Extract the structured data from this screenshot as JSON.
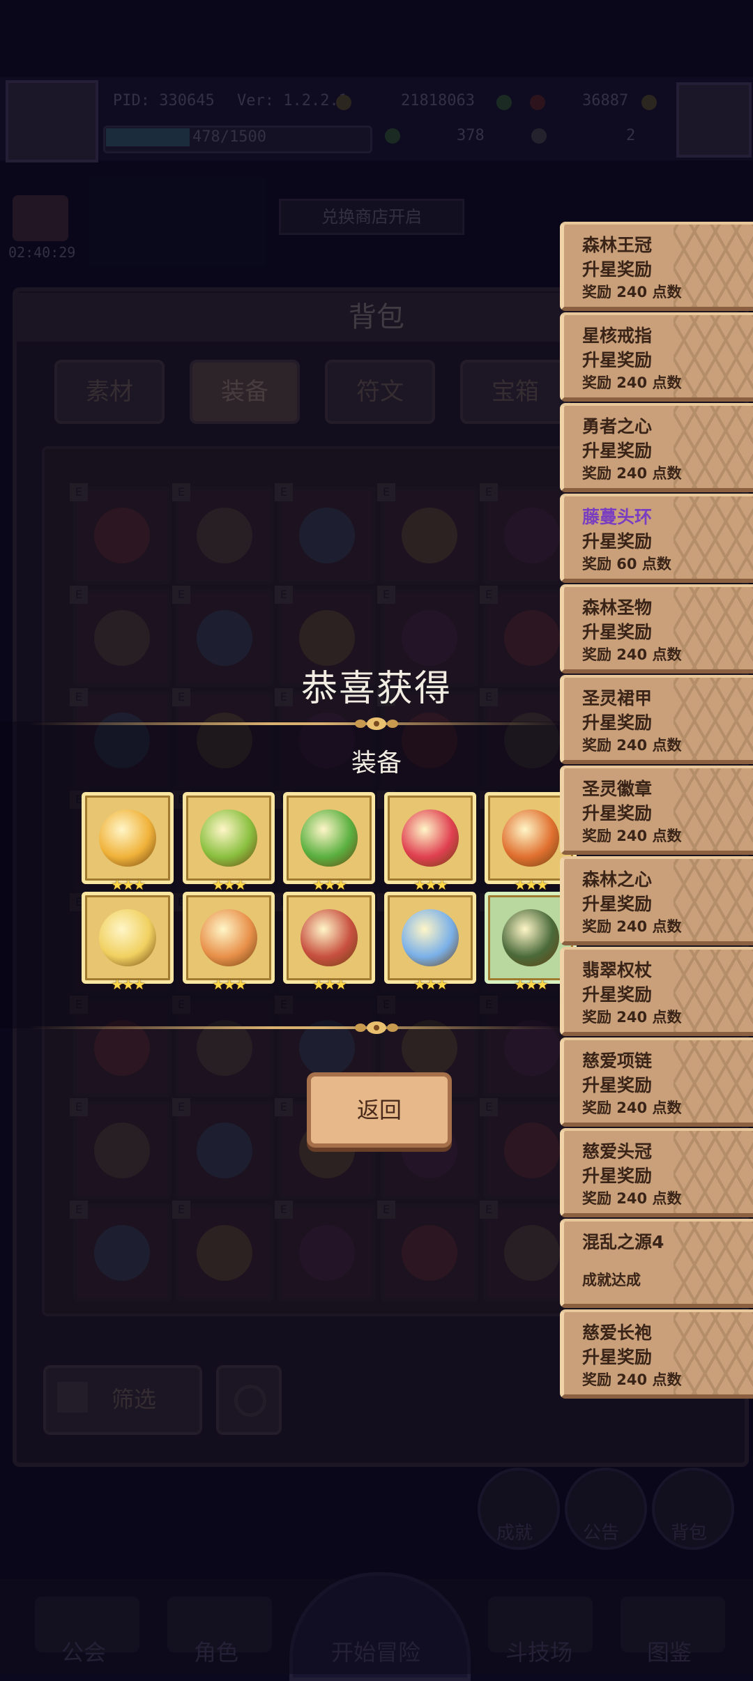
{
  "status_bar": {
    "pid": "PID: 330645",
    "version": "Ver: 1.2.2.1",
    "gold": "21818063",
    "gems": "36887",
    "clover": "378",
    "keys": "2",
    "xp": "478/1500",
    "xp_fraction": 0.32,
    "timer": "02:40:29"
  },
  "banner_text": "兑换商店开启",
  "bag": {
    "title": "背包",
    "tabs": [
      "素材",
      "装备",
      "符文",
      "宝箱"
    ],
    "selected_tab": "装备",
    "filter_label": "筛选"
  },
  "reward_popup": {
    "title": "恭喜获得",
    "subtitle": "装备",
    "back_button": "返回",
    "items": [
      {
        "icon": "golden-robe-icon",
        "stars": "★★★"
      },
      {
        "icon": "green-staff-icon",
        "stars": "★★★"
      },
      {
        "icon": "emerald-scepter-icon",
        "stars": "★★★"
      },
      {
        "icon": "heart-crown-icon",
        "stars": "★★★"
      },
      {
        "icon": "forest-crown-icon",
        "stars": "★★★"
      },
      {
        "icon": "star-core-ring-icon",
        "stars": "★★★"
      },
      {
        "icon": "brave-heart-icon",
        "stars": "★★★"
      },
      {
        "icon": "love-necklace-icon",
        "stars": "★★★"
      },
      {
        "icon": "crystal-pendant-icon",
        "stars": "★★★"
      },
      {
        "icon": "forest-relic-icon",
        "stars": "★★★"
      }
    ]
  },
  "notifications": [
    {
      "title": "森林王冠",
      "subtitle": "升星奖励",
      "points": "奖励 240 点数"
    },
    {
      "title": "星核戒指",
      "subtitle": "升星奖励",
      "points": "奖励 240 点数"
    },
    {
      "title": "勇者之心",
      "subtitle": "升星奖励",
      "points": "奖励 240 点数"
    },
    {
      "title": "藤蔓头环",
      "subtitle": "升星奖励",
      "points": "奖励 60 点数",
      "title_color": "#7a3fc0"
    },
    {
      "title": "森林圣物",
      "subtitle": "升星奖励",
      "points": "奖励 240 点数"
    },
    {
      "title": "圣灵裙甲",
      "subtitle": "升星奖励",
      "points": "奖励 240 点数"
    },
    {
      "title": "圣灵徽章",
      "subtitle": "升星奖励",
      "points": "奖励 240 点数"
    },
    {
      "title": "森林之心",
      "subtitle": "升星奖励",
      "points": "奖励 240 点数"
    },
    {
      "title": "翡翠权杖",
      "subtitle": "升星奖励",
      "points": "奖励 240 点数"
    },
    {
      "title": "慈爱项链",
      "subtitle": "升星奖励",
      "points": "奖励 240 点数"
    },
    {
      "title": "慈爱头冠",
      "subtitle": "升星奖励",
      "points": "奖励 240 点数"
    },
    {
      "title": "混乱之源4",
      "subtitle": "成就达成",
      "points": ""
    },
    {
      "title": "慈爱长袍",
      "subtitle": "升星奖励",
      "points": "奖励 240 点数"
    }
  ],
  "side_buttons": [
    "成就",
    "公告",
    "背包"
  ],
  "bottom_nav": [
    "公会",
    "角色",
    "开始冒险",
    "斗技场",
    "图鉴"
  ],
  "colors": {
    "gold_frame": "#e8c570",
    "notif_bg": "#c9a07a",
    "purple_title": "#7a3fc0",
    "background": "#0b0920"
  }
}
